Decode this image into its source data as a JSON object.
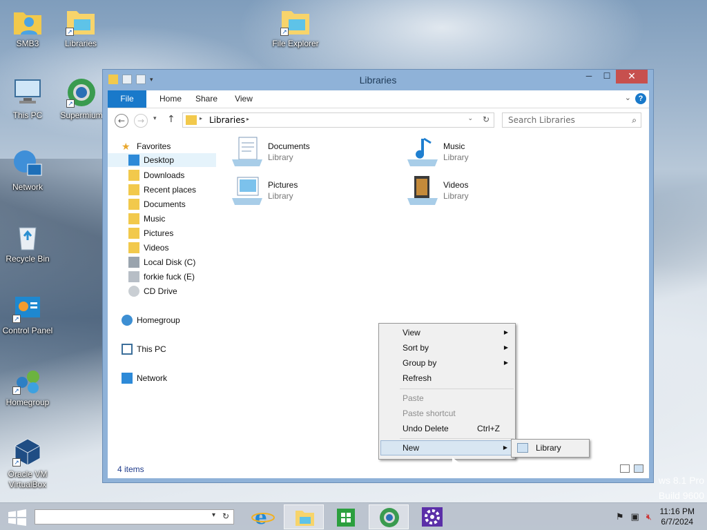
{
  "desktop": {
    "icons": [
      {
        "label": "SMB3"
      },
      {
        "label": "Libraries"
      },
      {
        "label": "File Explorer"
      },
      {
        "label": "This PC"
      },
      {
        "label": "Supermium"
      },
      {
        "label": "Network"
      },
      {
        "label": "Recycle Bin"
      },
      {
        "label": "Control Panel"
      },
      {
        "label": "Homegroup"
      },
      {
        "label": "Oracle VM VirtualBox"
      }
    ]
  },
  "window": {
    "title": "Libraries",
    "controls": {
      "minimize": "─",
      "maximize": "☐",
      "close": "✕"
    },
    "ribbon_tabs": [
      "File",
      "Home",
      "Share",
      "View"
    ],
    "help": "?",
    "address": {
      "crumb": "Libraries"
    },
    "search": {
      "placeholder": "Search Libraries"
    },
    "nav": {
      "favorites_header": "Favorites",
      "favorites": [
        "Desktop",
        "Downloads",
        "Recent places",
        "Documents",
        "Music",
        "Pictures",
        "Videos",
        "Local Disk (C)",
        "forkie fuck (E)",
        "CD Drive"
      ],
      "homegroup": "Homegroup",
      "this_pc": "This PC",
      "network": "Network"
    },
    "libraries": [
      {
        "name": "Documents",
        "type": "Library"
      },
      {
        "name": "Music",
        "type": "Library"
      },
      {
        "name": "Pictures",
        "type": "Library"
      },
      {
        "name": "Videos",
        "type": "Library"
      }
    ],
    "status": "4 items"
  },
  "context_menu": {
    "items": [
      {
        "label": "View",
        "submenu": true
      },
      {
        "label": "Sort by",
        "submenu": true
      },
      {
        "label": "Group by",
        "submenu": true
      },
      {
        "label": "Refresh"
      },
      {
        "label": "Paste",
        "disabled": true
      },
      {
        "label": "Paste shortcut",
        "disabled": true
      },
      {
        "label": "Undo Delete",
        "shortcut": "Ctrl+Z"
      },
      {
        "label": "New",
        "submenu": true,
        "highlighted": true
      }
    ],
    "submenu_new": [
      "Library"
    ]
  },
  "watermark": {
    "line1": "ws 8.1 Pro",
    "line2": "Build 9600"
  },
  "taskbar": {
    "clock_time": "11:16 PM",
    "clock_date": "6/7/2024"
  },
  "colors": {
    "accent": "#1979ca",
    "close": "#c7504e",
    "menu_hover": "#d8e6f2"
  }
}
